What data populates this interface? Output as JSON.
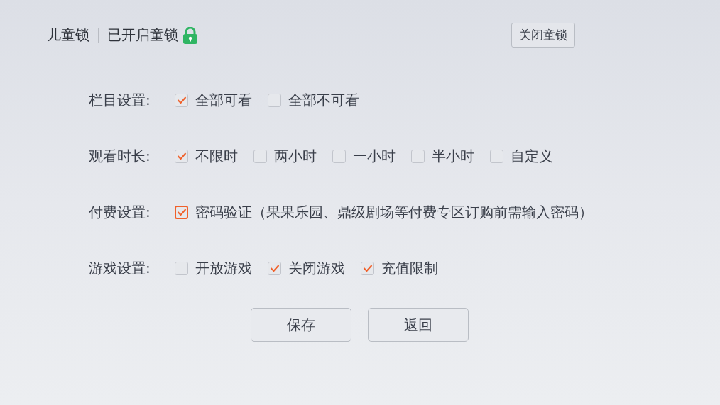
{
  "header": {
    "title": "儿童锁",
    "status": "已开启童锁",
    "locked": true,
    "close_button": "关闭童锁"
  },
  "settings": [
    {
      "label": "栏目设置:",
      "options": [
        {
          "label": "全部可看",
          "checked": true,
          "focused": false
        },
        {
          "label": "全部不可看",
          "checked": false,
          "focused": false
        }
      ]
    },
    {
      "label": "观看时长:",
      "options": [
        {
          "label": "不限时",
          "checked": true,
          "focused": false
        },
        {
          "label": "两小时",
          "checked": false,
          "focused": false
        },
        {
          "label": "一小时",
          "checked": false,
          "focused": false
        },
        {
          "label": "半小时",
          "checked": false,
          "focused": false
        },
        {
          "label": "自定义",
          "checked": false,
          "focused": false
        }
      ]
    },
    {
      "label": "付费设置:",
      "options": [
        {
          "label": "密码验证（果果乐园、鼎级剧场等付费专区订购前需输入密码）",
          "checked": true,
          "focused": true
        }
      ]
    },
    {
      "label": "游戏设置:",
      "options": [
        {
          "label": "开放游戏",
          "checked": false,
          "focused": false
        },
        {
          "label": "关闭游戏",
          "checked": true,
          "focused": false
        },
        {
          "label": "充值限制",
          "checked": true,
          "focused": false
        }
      ]
    }
  ],
  "buttons": [
    "保存",
    "返回"
  ]
}
